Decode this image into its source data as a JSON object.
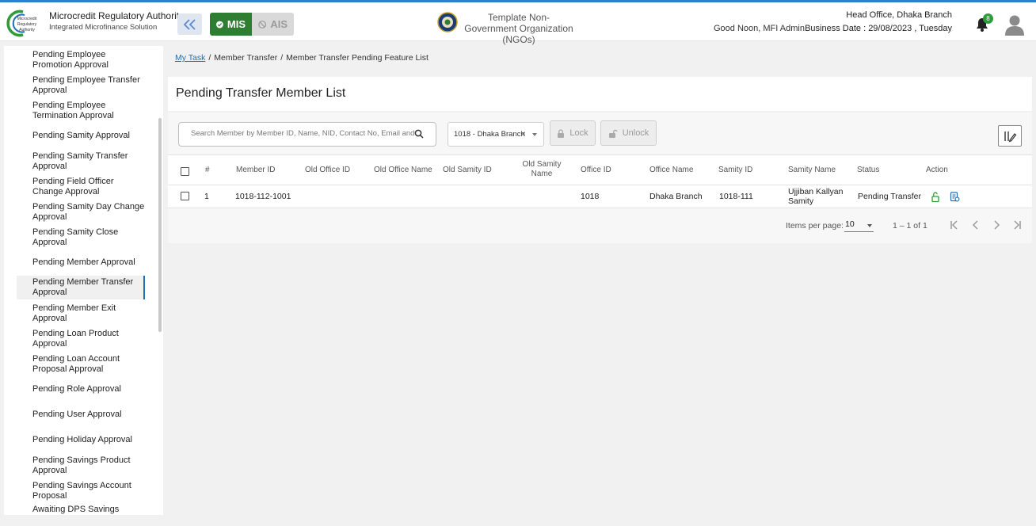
{
  "header": {
    "brand_name": "Microcredit Regulatory Authority",
    "brand_sub": "Integrated Microfinance Solution",
    "logo_text": [
      "Microcredit",
      "Regulatory",
      "Authority"
    ],
    "mode_mis": "MIS",
    "mode_ais": "AIS",
    "org_name": "Template Non-Government Organization (NGOs)",
    "greeting": "Good Noon, MFI Admin",
    "branch": "Head Office, Dhaka Branch",
    "business_date": "Business Date : 29/08/2023 , Tuesday",
    "notification_count": "8"
  },
  "sidebar": {
    "items": [
      {
        "label": "Pending Employee Promotion Approval"
      },
      {
        "label": "Pending Employee Transfer Approval"
      },
      {
        "label": "Pending Employee Termination Approval"
      },
      {
        "label": "Pending Samity Approval"
      },
      {
        "label": "Pending Samity Transfer Approval"
      },
      {
        "label": "Pending Field Officer Change Approval"
      },
      {
        "label": "Pending Samity Day Change Approval"
      },
      {
        "label": "Pending Samity Close Approval"
      },
      {
        "label": "Pending Member Approval"
      },
      {
        "label": "Pending Member Transfer Approval"
      },
      {
        "label": "Pending Member Exit Approval"
      },
      {
        "label": "Pending Loan Product Approval"
      },
      {
        "label": "Pending Loan Account Proposal Approval"
      },
      {
        "label": "Pending Role Approval"
      },
      {
        "label": "Pending User Approval"
      },
      {
        "label": "Pending Holiday Approval"
      },
      {
        "label": "Pending Savings Product Approval"
      },
      {
        "label": "Pending Savings Account Proposal"
      },
      {
        "label": "Awaiting DPS Savings"
      }
    ],
    "active_index": 9
  },
  "breadcrumb": {
    "items": [
      "My Task",
      "Member Transfer",
      "Member Transfer Pending Feature List"
    ],
    "separator": "/"
  },
  "page": {
    "title": "Pending Transfer Member List"
  },
  "toolbar": {
    "search_placeholder": "Search Member by Member ID, Name, NID, Contact No, Email and Status",
    "branch_value": "1018 - Dhaka Branch",
    "lock_label": "Lock",
    "unlock_label": "Unlock"
  },
  "table": {
    "columns": [
      "#",
      "Member ID",
      "Old Office ID",
      "Old Office Name",
      "Old Samity ID",
      "Old Samity Name",
      "Office ID",
      "Office Name",
      "Samity ID",
      "Samity Name",
      "Status",
      "Action"
    ],
    "rows": [
      {
        "index": "1",
        "member_id": "1018-112-1001",
        "old_office_id": "",
        "old_office_name": "",
        "old_samity_id": "",
        "old_samity_name": "",
        "office_id": "1018",
        "office_name": "Dhaka Branch",
        "samity_id": "1018-111",
        "samity_name": "Ujjiban Kallyan Samity",
        "status": "Pending Transfer"
      }
    ]
  },
  "pagination": {
    "items_per_page_label": "Items per page:",
    "items_per_page": "10",
    "range": "1 – 1 of 1"
  },
  "colors": {
    "accent": "#1f6fb2",
    "mis_green": "#2e7d32",
    "badge_green": "#2e9c3a",
    "action_green": "#2e9c3a",
    "action_blue": "#1f6fb2"
  }
}
